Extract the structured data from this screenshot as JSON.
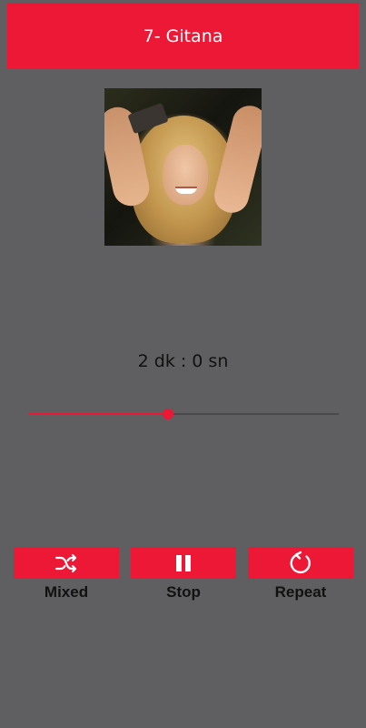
{
  "header": {
    "title": "7- Gitana"
  },
  "album_art": {
    "alt": "album-cover-photo"
  },
  "player": {
    "time_display": "2 dk : 0 sn",
    "progress_fraction": 0.45
  },
  "controls": [
    {
      "id": "mixed",
      "label": "Mixed",
      "icon": "shuffle-icon"
    },
    {
      "id": "stop",
      "label": "Stop",
      "icon": "pause-icon"
    },
    {
      "id": "repeat",
      "label": "Repeat",
      "icon": "repeat-icon"
    }
  ],
  "colors": {
    "accent": "#ec1836",
    "background": "#5f5f61",
    "text": "#111111"
  }
}
